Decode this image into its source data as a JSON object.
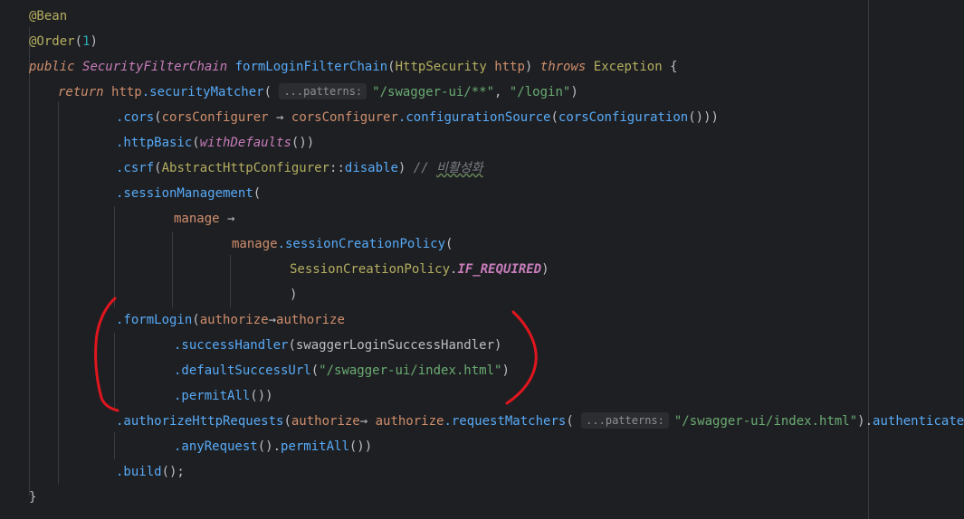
{
  "editor": {
    "lines": [
      [
        {
          "t": "@Bean",
          "c": "ann"
        }
      ],
      [
        {
          "t": "@Order",
          "c": "ann"
        },
        {
          "t": "(",
          "c": "paren"
        },
        {
          "t": "1",
          "c": "num"
        },
        {
          "t": ")",
          "c": "paren"
        }
      ],
      [
        {
          "t": "public ",
          "c": "kwi"
        },
        {
          "t": "SecurityFilterChain ",
          "c": "iface"
        },
        {
          "t": "formLoginFilterChain",
          "c": "fn"
        },
        {
          "t": "(",
          "c": "paren"
        },
        {
          "t": "HttpSecurity ",
          "c": "ann"
        },
        {
          "t": "http",
          "c": "kw"
        },
        {
          "t": ") ",
          "c": "paren"
        },
        {
          "t": "throws ",
          "c": "kwi"
        },
        {
          "t": "Exception ",
          "c": "ann"
        },
        {
          "t": "{",
          "c": "paren"
        }
      ],
      [
        {
          "t": "return ",
          "c": "kwi"
        },
        {
          "t": "http",
          "c": "kw"
        },
        {
          "t": ".securityMatcher",
          "c": "call"
        },
        {
          "t": "( ",
          "c": "paren"
        },
        {
          "hint": "...patterns:"
        },
        {
          "t": "\"/swagger-ui/**\"",
          "c": "str"
        },
        {
          "t": ", ",
          "c": "paren"
        },
        {
          "t": "\"/login\"",
          "c": "str"
        },
        {
          "t": ")",
          "c": "paren"
        }
      ],
      [
        {
          "t": ".cors",
          "c": "call"
        },
        {
          "t": "(",
          "c": "paren"
        },
        {
          "t": "corsConfigurer ",
          "c": "kw"
        },
        {
          "t": "→ ",
          "c": "paren"
        },
        {
          "t": "corsConfigurer",
          "c": "kw"
        },
        {
          "t": ".configurationSource",
          "c": "call"
        },
        {
          "t": "(",
          "c": "paren"
        },
        {
          "t": "corsConfiguration",
          "c": "call"
        },
        {
          "t": "()))",
          "c": "paren"
        }
      ],
      [
        {
          "t": ".httpBasic",
          "c": "call"
        },
        {
          "t": "(",
          "c": "paren"
        },
        {
          "t": "withDefaults",
          "c": "iface"
        },
        {
          "t": "())",
          "c": "paren"
        }
      ],
      [
        {
          "t": ".csrf",
          "c": "call"
        },
        {
          "t": "(",
          "c": "paren"
        },
        {
          "t": "AbstractHttpConfigurer",
          "c": "ann"
        },
        {
          "t": "::",
          "c": "paren"
        },
        {
          "t": "disable",
          "c": "call"
        },
        {
          "t": ") ",
          "c": "paren"
        },
        {
          "t": "// ",
          "c": "cmt"
        },
        {
          "t": "비활성화",
          "c": "typo"
        }
      ],
      [
        {
          "t": ".sessionManagement",
          "c": "call"
        },
        {
          "t": "(",
          "c": "paren"
        }
      ],
      [
        {
          "t": "manage ",
          "c": "kw"
        },
        {
          "t": "→",
          "c": "paren"
        }
      ],
      [
        {
          "t": "manage",
          "c": "kw"
        },
        {
          "t": ".sessionCreationPolicy",
          "c": "call"
        },
        {
          "t": "(",
          "c": "paren"
        }
      ],
      [
        {
          "t": "SessionCreationPolicy",
          "c": "ann"
        },
        {
          "t": ".",
          "c": "paren"
        },
        {
          "t": "IF_REQUIRED",
          "c": "static"
        },
        {
          "t": ")",
          "c": "paren"
        }
      ],
      [
        {
          "t": ")",
          "c": "paren"
        }
      ],
      [
        {
          "t": ".formLogin",
          "c": "call"
        },
        {
          "t": "(",
          "c": "paren"
        },
        {
          "t": "authorize",
          "c": "kw"
        },
        {
          "t": "→",
          "c": "paren"
        },
        {
          "t": "authorize",
          "c": "kw"
        }
      ],
      [
        {
          "t": ".successHandler",
          "c": "call"
        },
        {
          "t": "(",
          "c": "paren"
        },
        {
          "t": "swaggerLoginSuccessHandler",
          "c": "param"
        },
        {
          "t": ")",
          "c": "paren"
        }
      ],
      [
        {
          "t": ".defaultSuccessUrl",
          "c": "call"
        },
        {
          "t": "(",
          "c": "paren"
        },
        {
          "t": "\"/swagger-ui/index.html\"",
          "c": "str"
        },
        {
          "t": ")",
          "c": "paren"
        }
      ],
      [
        {
          "t": ".permitAll",
          "c": "call"
        },
        {
          "t": "())",
          "c": "paren"
        }
      ],
      [
        {
          "t": ".authorizeHttpRequests",
          "c": "call"
        },
        {
          "t": "(",
          "c": "paren"
        },
        {
          "t": "authorize",
          "c": "kw"
        },
        {
          "t": "→ ",
          "c": "paren"
        },
        {
          "t": "authorize",
          "c": "kw"
        },
        {
          "t": ".requestMatchers",
          "c": "call"
        },
        {
          "t": "( ",
          "c": "paren"
        },
        {
          "hint": "...patterns:"
        },
        {
          "t": "\"/swagger-ui/index.html\"",
          "c": "str"
        },
        {
          "t": ").",
          "c": "paren"
        },
        {
          "t": "authenticated",
          "c": "call"
        },
        {
          "t": "()",
          "c": "paren"
        }
      ],
      [
        {
          "t": ".anyRequest",
          "c": "call"
        },
        {
          "t": "().",
          "c": "paren"
        },
        {
          "t": "permitAll",
          "c": "call"
        },
        {
          "t": "())",
          "c": "paren"
        }
      ],
      [
        {
          "t": ".build",
          "c": "call"
        },
        {
          "t": "();",
          "c": "paren"
        }
      ],
      [
        {
          "t": "}",
          "c": "paren"
        }
      ]
    ]
  },
  "colors": {
    "background": "#1e1f22",
    "annotation_marker": "#e0161f"
  }
}
